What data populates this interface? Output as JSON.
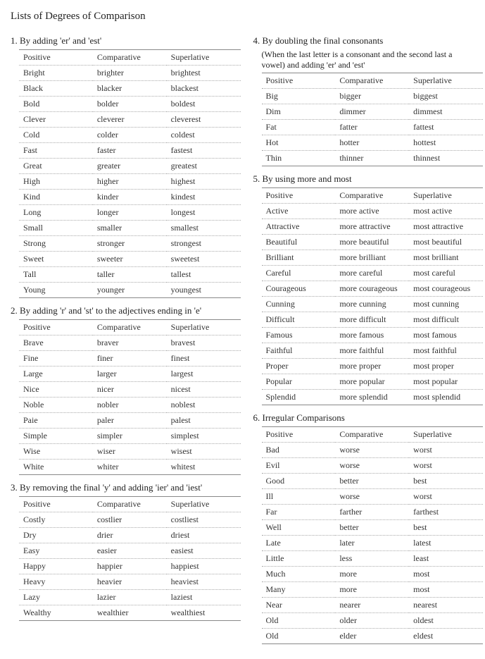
{
  "title": "Lists of Degrees of Comparison",
  "headers": {
    "positive": "Positive",
    "comparative": "Comparative",
    "superlative": "Superlative"
  },
  "sections": [
    {
      "num": "1.",
      "title": "By adding 'er' and 'est'",
      "rows": [
        [
          "Bright",
          "brighter",
          "brightest"
        ],
        [
          "Black",
          "blacker",
          "blackest"
        ],
        [
          "Bold",
          "bolder",
          "boldest"
        ],
        [
          "Clever",
          "cleverer",
          "cleverest"
        ],
        [
          "Cold",
          "colder",
          "coldest"
        ],
        [
          "Fast",
          "faster",
          "fastest"
        ],
        [
          "Great",
          "greater",
          "greatest"
        ],
        [
          "High",
          "higher",
          "highest"
        ],
        [
          "Kind",
          "kinder",
          "kindest"
        ],
        [
          "Long",
          "longer",
          "longest"
        ],
        [
          "Small",
          "smaller",
          "smallest"
        ],
        [
          "Strong",
          "stronger",
          "strongest"
        ],
        [
          "Sweet",
          "sweeter",
          "sweetest"
        ],
        [
          "Tall",
          "taller",
          "tallest"
        ],
        [
          "Young",
          "younger",
          "youngest"
        ]
      ]
    },
    {
      "num": "2.",
      "title": "By adding 'r' and 'st' to the adjectives ending in 'e'",
      "rows": [
        [
          "Brave",
          "braver",
          "bravest"
        ],
        [
          "Fine",
          "finer",
          "finest"
        ],
        [
          "Large",
          "larger",
          "largest"
        ],
        [
          "Nice",
          "nicer",
          "nicest"
        ],
        [
          "Noble",
          "nobler",
          "noblest"
        ],
        [
          "Paie",
          "paler",
          "palest"
        ],
        [
          "Simple",
          "simpler",
          "simplest"
        ],
        [
          "Wise",
          "wiser",
          "wisest"
        ],
        [
          "White",
          "whiter",
          "whitest"
        ]
      ]
    },
    {
      "num": "3.",
      "title": "By removing the final 'y' and adding 'ier' and 'iest'",
      "rows": [
        [
          "Costly",
          "costlier",
          "costliest"
        ],
        [
          "Dry",
          "drier",
          "driest"
        ],
        [
          "Easy",
          "easier",
          "easiest"
        ],
        [
          "Happy",
          "happier",
          "happiest"
        ],
        [
          "Heavy",
          "heavier",
          "heaviest"
        ],
        [
          "Lazy",
          "lazier",
          "laziest"
        ],
        [
          "Wealthy",
          "wealthier",
          "wealthiest"
        ]
      ]
    },
    {
      "num": "4.",
      "title": "By doubling the final consonants",
      "note": "(When the last letter is a consonant and the second last a vowel) and adding 'er' and 'est'",
      "rows": [
        [
          "Big",
          "bigger",
          "biggest"
        ],
        [
          "Dim",
          "dimmer",
          "dimmest"
        ],
        [
          "Fat",
          "fatter",
          "fattest"
        ],
        [
          "Hot",
          "hotter",
          "hottest"
        ],
        [
          "Thin",
          "thinner",
          "thinnest"
        ]
      ]
    },
    {
      "num": "5.",
      "title": "By using more and most",
      "rows": [
        [
          "Active",
          "more active",
          "most active"
        ],
        [
          "Attractive",
          "more attractive",
          "most attractive"
        ],
        [
          "Beautiful",
          "more beautiful",
          "most beautiful"
        ],
        [
          "Brilliant",
          "more brilliant",
          "most brilliant"
        ],
        [
          "Careful",
          "more careful",
          "most careful"
        ],
        [
          "Courageous",
          "more courageous",
          "most courageous"
        ],
        [
          "Cunning",
          "more cunning",
          "most cunning"
        ],
        [
          "Difficult",
          "more difficult",
          "most difficult"
        ],
        [
          "Famous",
          "more famous",
          "most famous"
        ],
        [
          "Faithful",
          "more faithful",
          "most faithful"
        ],
        [
          "Proper",
          "more proper",
          "most proper"
        ],
        [
          "Popular",
          "more popular",
          "most popular"
        ],
        [
          "Splendid",
          "more splendid",
          "most splendid"
        ]
      ]
    },
    {
      "num": "6.",
      "title": "Irregular Comparisons",
      "rows": [
        [
          "Bad",
          "worse",
          "worst"
        ],
        [
          "Evil",
          "worse",
          "worst"
        ],
        [
          "Good",
          "better",
          "best"
        ],
        [
          "Ill",
          "worse",
          "worst"
        ],
        [
          "Far",
          "farther",
          "farthest"
        ],
        [
          "Well",
          "better",
          "best"
        ],
        [
          "Late",
          "later",
          "latest"
        ],
        [
          "Little",
          "less",
          "least"
        ],
        [
          "Much",
          "more",
          "most"
        ],
        [
          "Many",
          "more",
          "most"
        ],
        [
          "Near",
          "nearer",
          "nearest"
        ],
        [
          "Old",
          "older",
          "oldest"
        ],
        [
          "Old",
          "elder",
          "eldest"
        ]
      ]
    }
  ]
}
